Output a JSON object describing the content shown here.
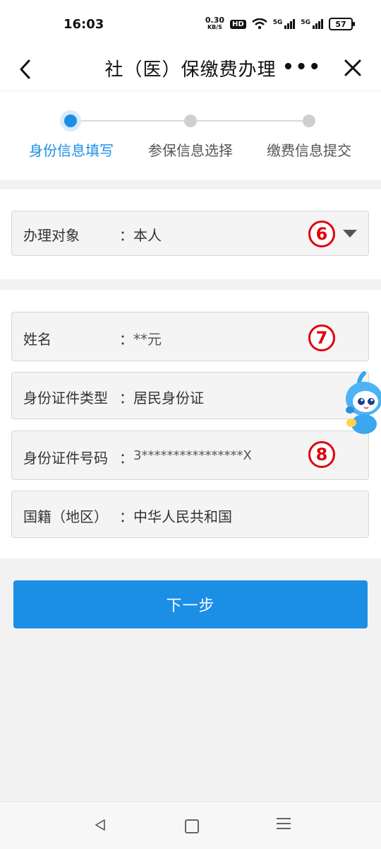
{
  "status": {
    "time": "16:03",
    "speed_value": "0.30",
    "speed_unit": "KB/S",
    "hd": "HD",
    "sim1": "5G",
    "sim2": "5G",
    "battery": "57"
  },
  "navbar": {
    "title": "社（医）保缴费办理",
    "more_label": "•••"
  },
  "steps": [
    {
      "label": "身份信息填写",
      "active": true
    },
    {
      "label": "参保信息选择",
      "active": false
    },
    {
      "label": "缴费信息提交",
      "active": false
    }
  ],
  "target": {
    "label": "办理对象",
    "colon": "：",
    "value": "本人"
  },
  "person": {
    "name_label": "姓名",
    "name_value": "**元",
    "id_type_label": "身份证件类型",
    "id_type_value": "居民身份证",
    "id_number_label": "身份证件号码",
    "id_number_value": "3****************X",
    "nationality_label": "国籍（地区）",
    "nationality_value": "中华人民共和国",
    "colon": "："
  },
  "markers": {
    "m6": "6",
    "m7": "7",
    "m8": "8"
  },
  "next_button": "下一步",
  "colors": {
    "primary": "#1b8ee6",
    "marker": "#e0000b"
  }
}
